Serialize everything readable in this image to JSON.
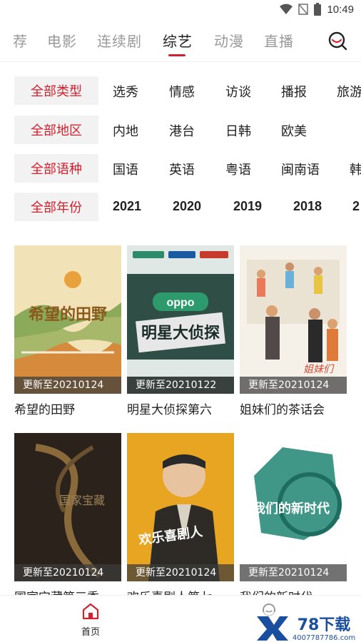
{
  "status": {
    "time": "10:49",
    "icons": [
      "wifi-icon",
      "signal-off-icon",
      "battery-icon"
    ]
  },
  "tabs": [
    {
      "label": "荐",
      "active": false
    },
    {
      "label": "电影",
      "active": false
    },
    {
      "label": "连续剧",
      "active": false
    },
    {
      "label": "综艺",
      "active": true
    },
    {
      "label": "动漫",
      "active": false
    },
    {
      "label": "直播",
      "active": false
    }
  ],
  "accent": "#d3202e",
  "filters": [
    {
      "all": "全部类型",
      "options": [
        "选秀",
        "情感",
        "访谈",
        "播报",
        "旅游"
      ]
    },
    {
      "all": "全部地区",
      "options": [
        "内地",
        "港台",
        "日韩",
        "欧美"
      ]
    },
    {
      "all": "全部语种",
      "options": [
        "国语",
        "英语",
        "粤语",
        "闽南语",
        "韩"
      ]
    },
    {
      "all": "全部年份",
      "options": [
        "2021",
        "2020",
        "2019",
        "2018",
        "2"
      ]
    }
  ],
  "items": [
    {
      "title": "希望的田野",
      "update": "更新至20210124",
      "poster_text": "希望的田野"
    },
    {
      "title": "明星大侦探第六",
      "update": "更新至20210122",
      "poster_text": "明星大侦探"
    },
    {
      "title": "姐妹们的茶话会",
      "update": "更新至20210124",
      "poster_text": "姐妹们"
    },
    {
      "title": "国家宝藏第三季",
      "update": "更新至20210124",
      "poster_text": "国家宝藏"
    },
    {
      "title": "欢乐喜剧人第七",
      "update": "更新至20210124",
      "poster_text": "欢乐喜剧人"
    },
    {
      "title": "我们的新时代",
      "update": "更新至20210124",
      "poster_text": "我们的新时代"
    }
  ],
  "bottom_nav": {
    "home_label": "首页"
  },
  "watermark": {
    "text": "78下载",
    "site": "4007787786.com"
  }
}
